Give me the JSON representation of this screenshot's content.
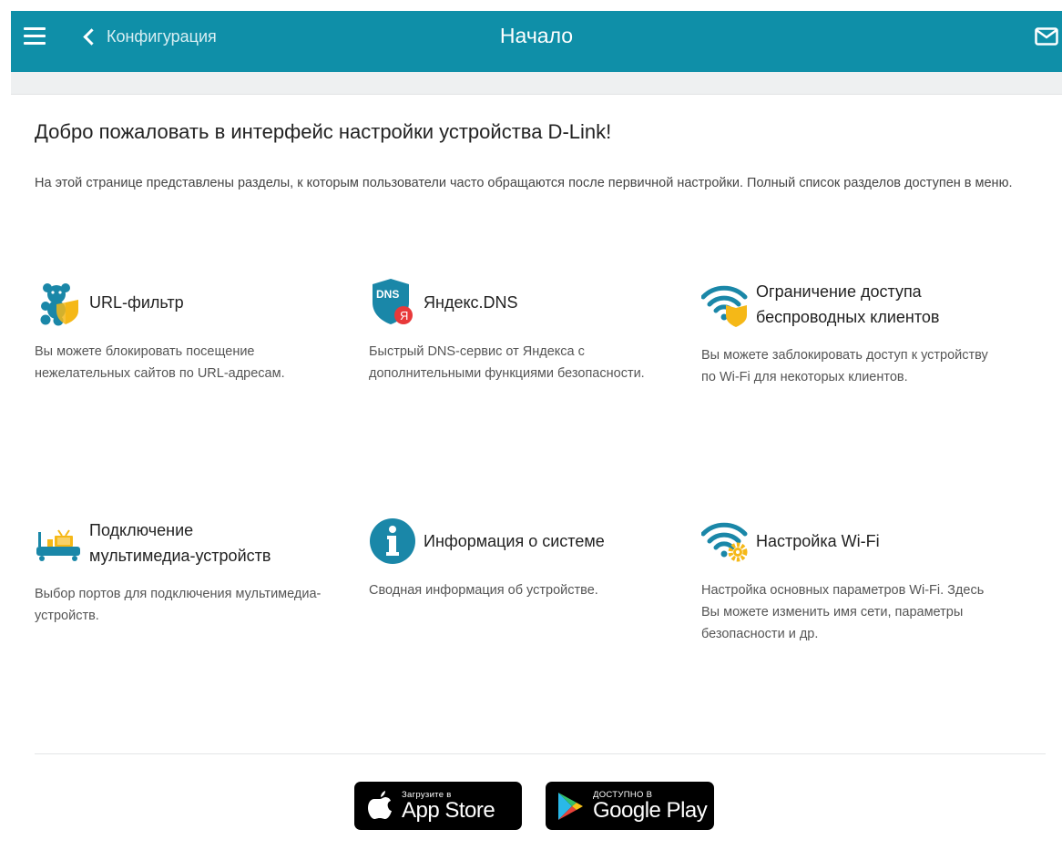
{
  "header": {
    "back_label": "Конфигурация",
    "title": "Начало"
  },
  "welcome": {
    "heading": "Добро пожаловать в интерфейс настройки устройства D-Link!",
    "intro": "На этой странице представлены разделы, к которым пользователи часто обращаются после первичной настройки. Полный список разделов доступен в меню."
  },
  "cards": [
    {
      "title": "URL-фильтр",
      "icon": "url-filter-icon",
      "description": "Вы можете блокировать посещение нежелательных сайтов по URL-адресам."
    },
    {
      "title": "Яндекс.DNS",
      "icon": "yandex-dns-icon",
      "icon_text": "DNS",
      "badge_text": "Я",
      "description": "Быстрый DNS-сервис от Яндекса с дополнительными функциями безопасности."
    },
    {
      "title_line1": "Ограничение доступа",
      "title_line2": "беспроводных клиентов",
      "icon": "wifi-shield-icon",
      "description": "Вы можете заблокировать доступ к устройству по Wi-Fi для некоторых клиентов."
    },
    {
      "title_line1": "Подключение",
      "title_line2": "мультимедиа-устройств",
      "icon": "multimedia-router-icon",
      "description": "Выбор портов для подключения мультимедиа-устройств."
    },
    {
      "title": "Информация о системе",
      "icon": "info-icon",
      "description": "Сводная информация об устройстве."
    },
    {
      "title": "Настройка Wi-Fi",
      "icon": "wifi-gear-icon",
      "description": "Настройка основных параметров Wi-Fi. Здесь Вы можете изменить имя сети, параметры безопасности и др."
    }
  ],
  "stores": {
    "appstore_small": "Загрузите в",
    "appstore_big": "App Store",
    "googleplay_small": "ДОСТУПНО В",
    "googleplay_big": "Google Play"
  },
  "colors": {
    "header": "#0f8fa8",
    "icon_teal": "#1a87a8",
    "shield_yellow": "#f5b817",
    "badge_red": "#e8393a"
  }
}
